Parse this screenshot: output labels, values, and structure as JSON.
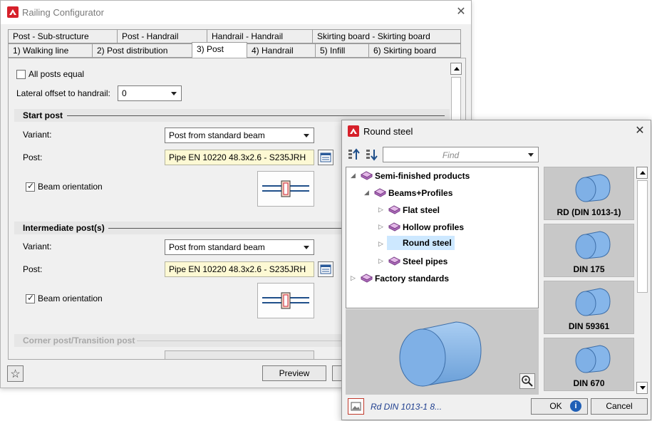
{
  "window1": {
    "title": "Railing Configurator",
    "tabs_row1": [
      "Post - Sub-structure",
      "Post - Handrail",
      "Handrail - Handrail",
      "Skirting board - Skirting board"
    ],
    "tabs_row2": [
      "1) Walking line",
      "2) Post distribution",
      "3) Post",
      "4) Handrail",
      "5) Infill",
      "6) Skirting board"
    ],
    "active_tab": "3) Post",
    "all_posts_equal": {
      "label": "All posts equal",
      "checked": false
    },
    "lateral_offset": {
      "label": "Lateral offset to handrail:",
      "value": "0"
    },
    "start_post": {
      "heading": "Start post",
      "variant_label": "Variant:",
      "variant_value": "Post from standard beam",
      "post_label": "Post:",
      "post_value": "Pipe EN 10220 48.3x2.6 - S235JRH",
      "beam_orientation_label": "Beam orientation",
      "beam_orientation_checked": true
    },
    "intermediate_post": {
      "heading": "Intermediate post(s)",
      "variant_label": "Variant:",
      "variant_value": "Post from standard beam",
      "post_label": "Post:",
      "post_value": "Pipe EN 10220 48.3x2.6 - S235JRH",
      "beam_orientation_label": "Beam orientation",
      "beam_orientation_checked": true
    },
    "corner_post": {
      "heading": "Corner post/Transition post"
    },
    "preview_button": "Preview",
    "favorite_icon": "star-icon"
  },
  "window2": {
    "title": "Round steel",
    "find_placeholder": "Find",
    "tree": [
      {
        "label": "Semi-finished products",
        "level": 0,
        "expanded": true
      },
      {
        "label": "Beams+Profiles",
        "level": 1,
        "expanded": true
      },
      {
        "label": "Flat steel",
        "level": 2,
        "expanded": false
      },
      {
        "label": "Hollow profiles",
        "level": 2,
        "expanded": false
      },
      {
        "label": "Round steel",
        "level": 2,
        "expanded": false,
        "selected": true
      },
      {
        "label": "Steel pipes",
        "level": 2,
        "expanded": false
      },
      {
        "label": "Factory standards",
        "level": 0,
        "expanded": false
      }
    ],
    "thumbnails": [
      "RD (DIN 1013-1)",
      "DIN 175",
      "DIN 59361",
      "DIN 670"
    ],
    "status_text": "Rd DIN 1013-1 8...",
    "ok_button": "OK",
    "cancel_button": "Cancel"
  },
  "colors": {
    "selection": "#cde8ff",
    "yellow_field": "#fdf9d4",
    "cylinder_blue": "#8bb9e8",
    "status_text": "#1f3f8f"
  }
}
